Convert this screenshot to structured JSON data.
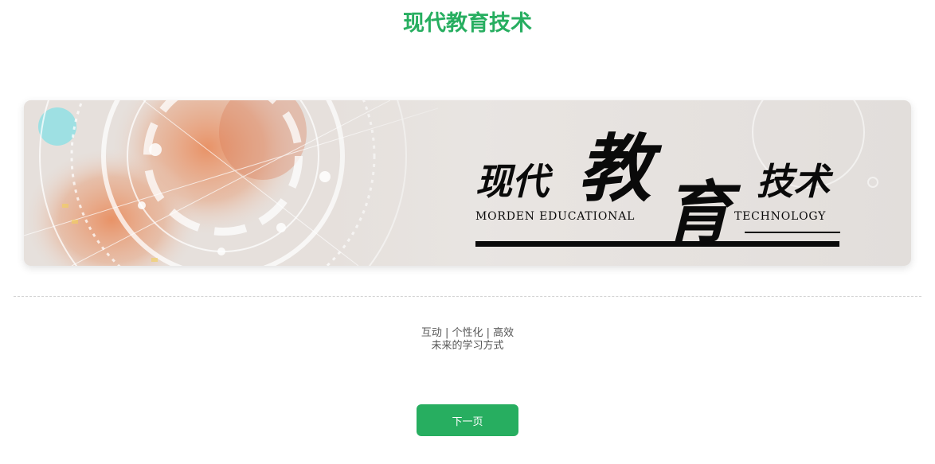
{
  "page": {
    "title": "现代教育技术"
  },
  "banner": {
    "title_part1": "现代",
    "title_part2": "教",
    "title_part3": "育",
    "title_part4": "技术",
    "subtitle_left": "MORDEN EDUCATIONAL",
    "subtitle_right": "TECHNOLOGY",
    "image_semantic": "technology-hand-circuit-background"
  },
  "tagline": {
    "line1": "互动 | 个性化 | 高效",
    "line2": "未来的学习方式"
  },
  "actions": {
    "next_label": "下一页"
  },
  "colors": {
    "accent": "#27ae60",
    "text_muted": "#555555",
    "divider": "#d4d4d4"
  }
}
